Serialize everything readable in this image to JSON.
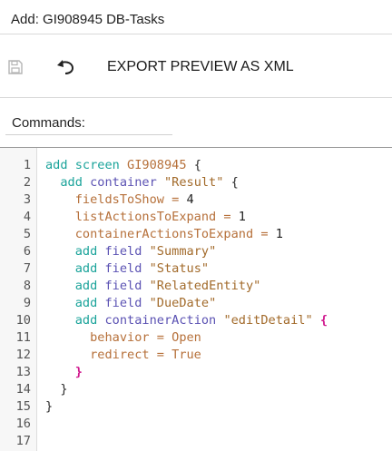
{
  "title_bar": {
    "title": "Add: GI908945 DB-Tasks"
  },
  "toolbar": {
    "save_icon": "floppy-disk-icon",
    "undo_icon": "undo-arrow-icon",
    "export_label": "EXPORT PREVIEW AS XML"
  },
  "commands": {
    "label": "Commands:"
  },
  "editor": {
    "line_numbers": [
      "1",
      "2",
      "3",
      "4",
      "5",
      "6",
      "7",
      "8",
      "9",
      "10",
      "11",
      "12",
      "13",
      "14",
      "15",
      "16",
      "17"
    ],
    "lines": [
      [
        {
          "t": "add screen ",
          "c": "kw"
        },
        {
          "t": "GI908945",
          "c": "var"
        },
        {
          "t": " {",
          "c": "sym"
        }
      ],
      [
        {
          "t": "  add ",
          "c": "kw"
        },
        {
          "t": "container ",
          "c": "id"
        },
        {
          "t": "\"Result\"",
          "c": "str"
        },
        {
          "t": " {",
          "c": "sym"
        }
      ],
      [
        {
          "t": "    fieldsToShow = ",
          "c": "var"
        },
        {
          "t": "4",
          "c": "num"
        }
      ],
      [
        {
          "t": "    listActionsToExpand = ",
          "c": "var"
        },
        {
          "t": "1",
          "c": "num"
        }
      ],
      [
        {
          "t": "    containerActionsToExpand = ",
          "c": "var"
        },
        {
          "t": "1",
          "c": "num"
        }
      ],
      [
        {
          "t": "    add ",
          "c": "kw"
        },
        {
          "t": "field ",
          "c": "id"
        },
        {
          "t": "\"Summary\"",
          "c": "str"
        }
      ],
      [
        {
          "t": "    add ",
          "c": "kw"
        },
        {
          "t": "field ",
          "c": "id"
        },
        {
          "t": "\"Status\"",
          "c": "str"
        }
      ],
      [
        {
          "t": "    add ",
          "c": "kw"
        },
        {
          "t": "field ",
          "c": "id"
        },
        {
          "t": "\"RelatedEntity\"",
          "c": "str"
        }
      ],
      [
        {
          "t": "    add ",
          "c": "kw"
        },
        {
          "t": "field ",
          "c": "id"
        },
        {
          "t": "\"DueDate\"",
          "c": "str"
        }
      ],
      [
        {
          "t": "    add ",
          "c": "kw"
        },
        {
          "t": "containerAction ",
          "c": "id"
        },
        {
          "t": "\"editDetail\"",
          "c": "str"
        },
        {
          "t": " {",
          "c": "brace"
        }
      ],
      [
        {
          "t": "      behavior = Open",
          "c": "var"
        }
      ],
      [
        {
          "t": "      redirect = True",
          "c": "var"
        }
      ],
      [
        {
          "t": "    }",
          "c": "brace"
        }
      ],
      [
        {
          "t": "  }",
          "c": "sym"
        }
      ],
      [
        {
          "t": "}",
          "c": "sym"
        }
      ],
      [],
      []
    ]
  },
  "colors": {
    "keyword": "#1aa39a",
    "identifier": "#5b52b3",
    "string": "#a26a2a",
    "brace_highlight": "#d0178d"
  }
}
